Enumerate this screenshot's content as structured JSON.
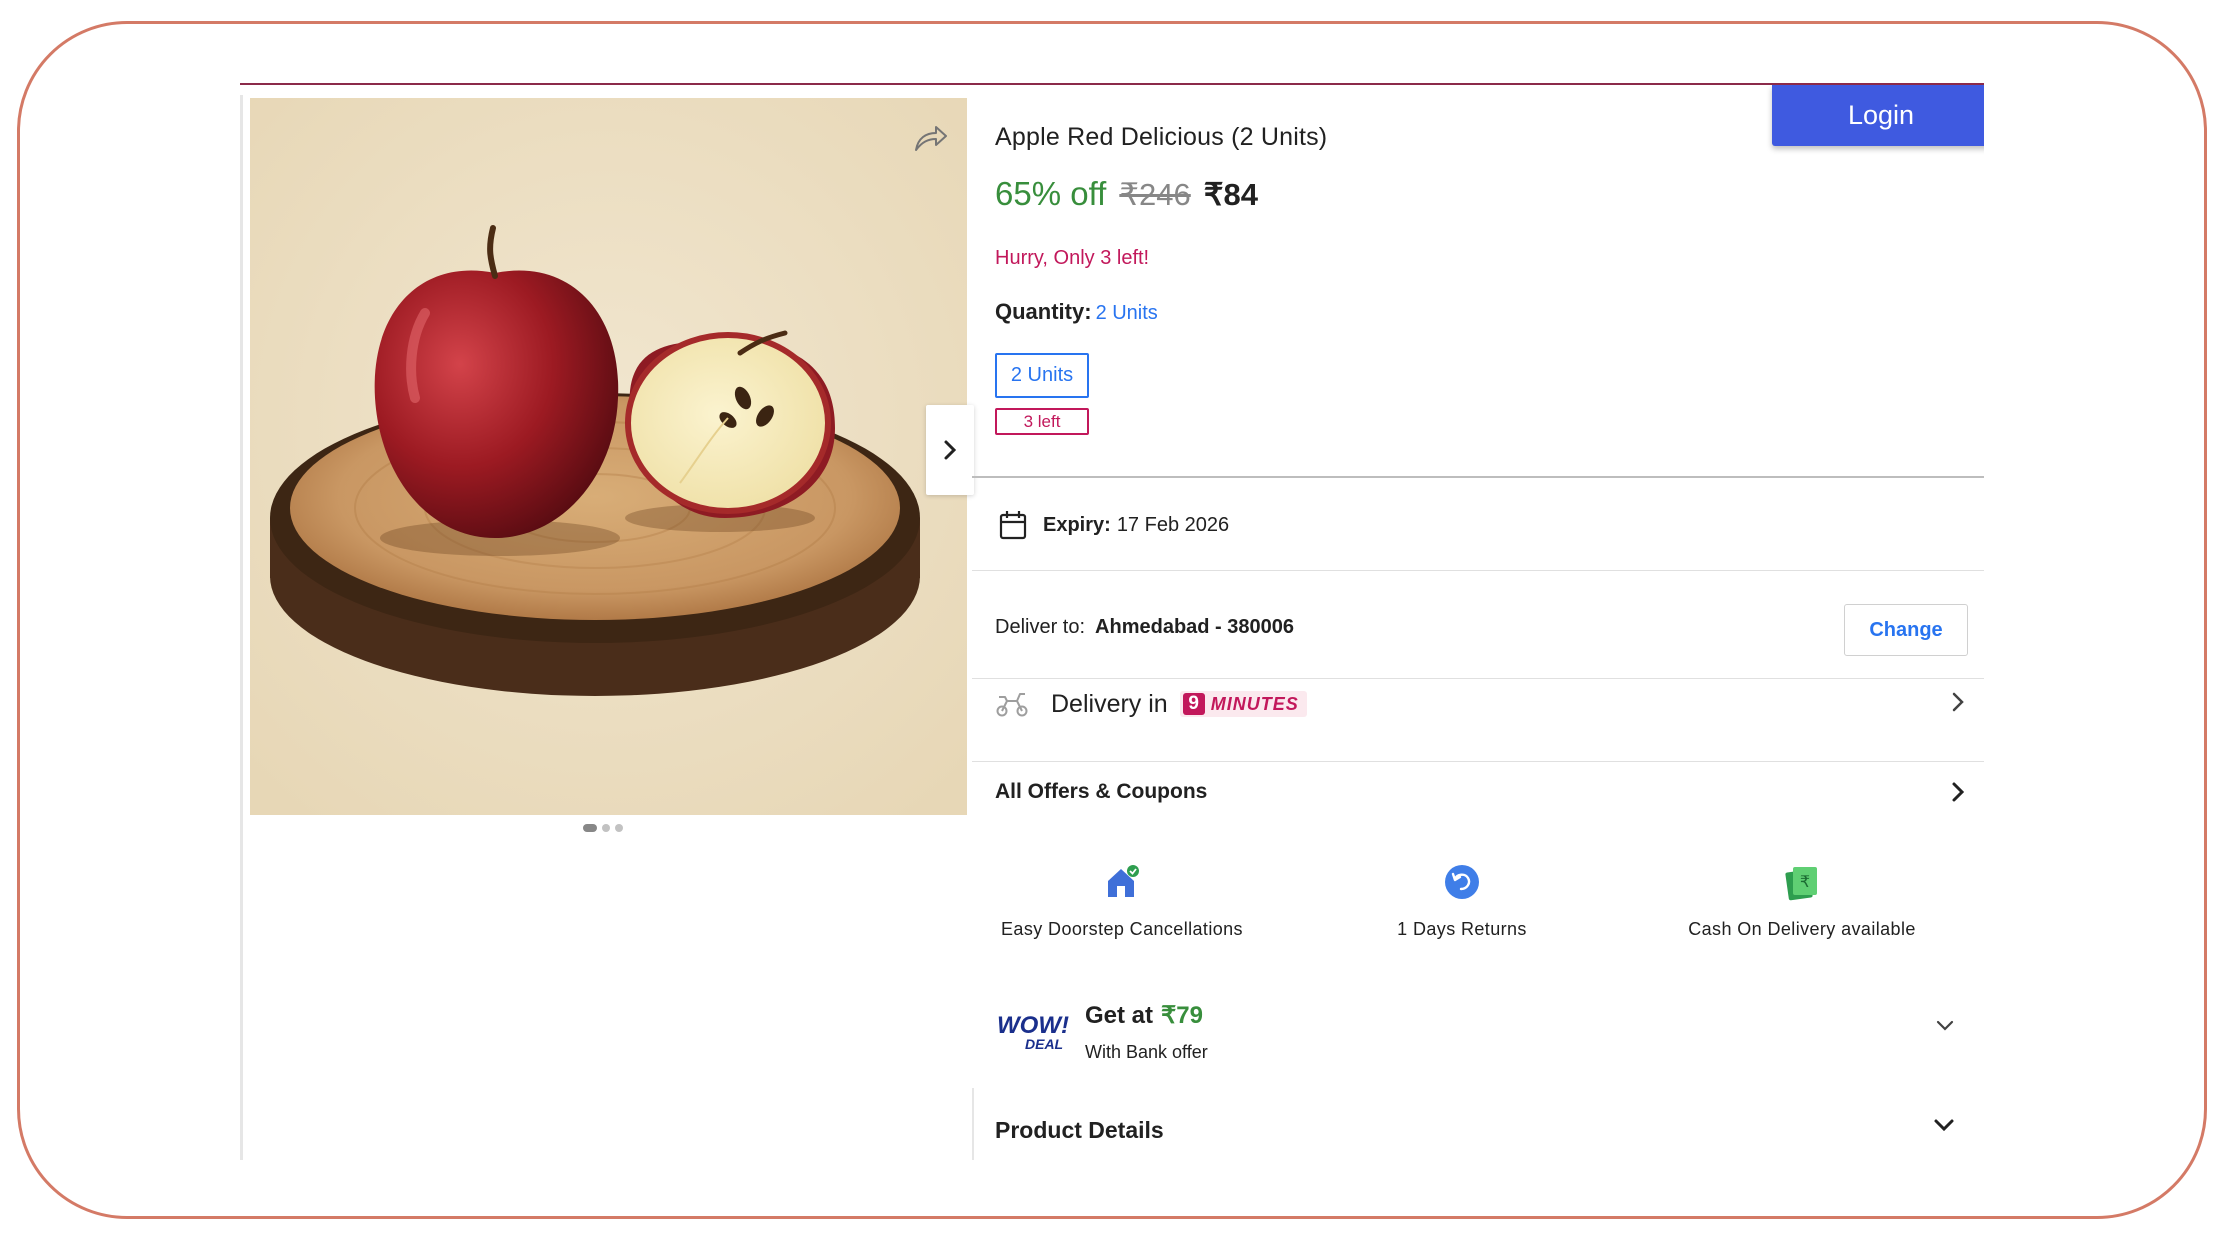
{
  "header": {
    "login_label": "Login"
  },
  "product": {
    "title": "Apple Red Delicious (2 Units)",
    "discount": "65% off",
    "mrp": "₹246",
    "price": "₹84",
    "stock_alert": "Hurry, Only 3 left!",
    "quantity_label": "Quantity:",
    "quantity_value": "2 Units",
    "unit_option": "2 Units",
    "unit_stock": "3 left",
    "image_alt": "apple-product-image",
    "gallery_dots": 3,
    "gallery_active_index": 0
  },
  "expiry": {
    "label": "Expiry:",
    "value": "17 Feb 2026"
  },
  "delivery": {
    "deliver_to_label": "Deliver to:",
    "location": "Ahmedabad - 380006",
    "change_label": "Change",
    "delivery_in_label": "Delivery in",
    "minutes_number": "9",
    "minutes_word": "MINUTES"
  },
  "offers": {
    "label": "All Offers & Coupons"
  },
  "features": [
    {
      "icon": "house-check-icon",
      "label": "Easy Doorstep Cancellations"
    },
    {
      "icon": "return-icon",
      "label": "1 Days Returns"
    },
    {
      "icon": "cash-icon",
      "label": "Cash On Delivery available"
    }
  ],
  "wow_deal": {
    "logo_top": "WOW!",
    "logo_bottom": "DEAL",
    "get_at_label": "Get at",
    "amount": "₹79",
    "subtext": "With Bank offer"
  },
  "product_details": {
    "label": "Product Details"
  },
  "colors": {
    "accent_blue": "#2874f0",
    "login_blue": "#3f5ae0",
    "discount_green": "#388e3c",
    "alert_pink": "#c2185b",
    "frame_border": "#d47a66"
  }
}
